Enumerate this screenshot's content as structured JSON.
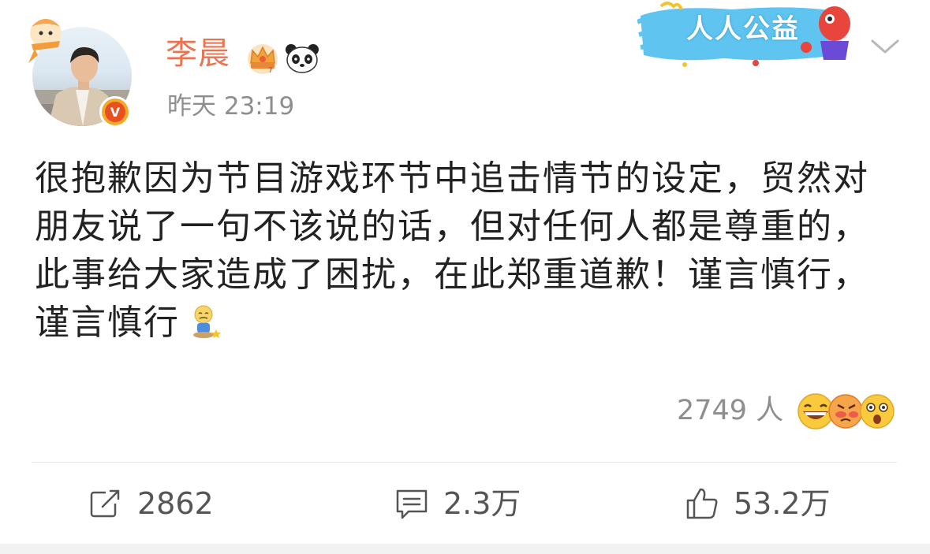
{
  "post": {
    "author_name": "李晨",
    "timestamp": "昨天 23:19",
    "body": "很抱歉因为节目游戏环节中追击情节的设定，贸然对朋友说了一句不该说的话，但对任何人都是尊重的，此事给大家造成了困扰，在此郑重道歉！谨言慎行，谨言慎行",
    "inline_emoji": "sitting-embarrassed-emoji"
  },
  "promo": {
    "text": "人人公益"
  },
  "reactions": {
    "count_text": "2749 人",
    "emojis": [
      "laughing-emoji",
      "angry-emoji",
      "shocked-emoji"
    ]
  },
  "actions": {
    "repost": "2862",
    "comment": "2.3万",
    "like": "53.2万"
  },
  "colors": {
    "username": "#eb7350",
    "secondary_text": "#8e8e8e",
    "body_text": "#222222",
    "verified_badge": "#f3a92a"
  }
}
